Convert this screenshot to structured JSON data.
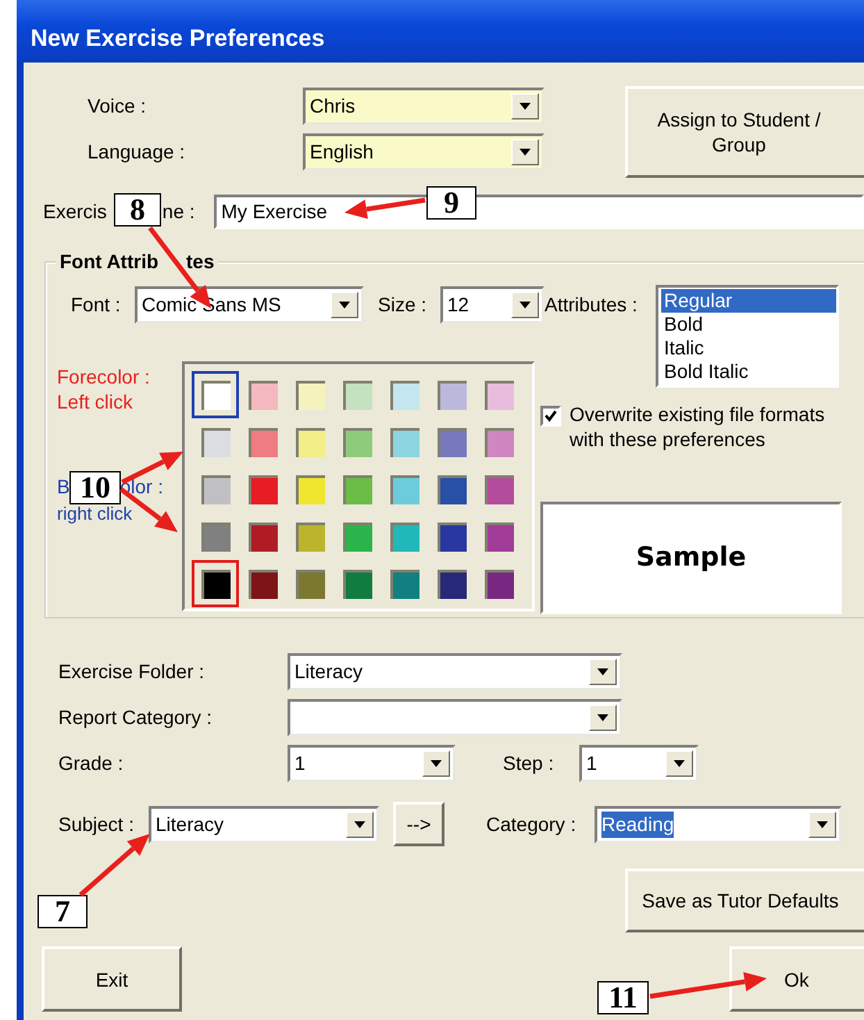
{
  "window": {
    "title": "New Exercise Preferences"
  },
  "voice": {
    "label": "Voice :",
    "value": "Chris"
  },
  "language": {
    "label": "Language :",
    "value": "English"
  },
  "assign_button": "Assign to Student / Group",
  "exercise_name": {
    "label_parts": [
      "Exercis",
      "ne :"
    ],
    "value": "My Exercise"
  },
  "font_attributes": {
    "title_parts": [
      "Font Attrib",
      "tes"
    ],
    "font": {
      "label": "Font :",
      "value": "Comic Sans MS"
    },
    "size": {
      "label": "Size :",
      "value": "12"
    },
    "attributes": {
      "label": "Attributes :",
      "options": [
        {
          "label": "Regular",
          "selected": true
        },
        {
          "label": "Bold",
          "selected": false
        },
        {
          "label": "Italic",
          "selected": false
        },
        {
          "label": "Bold Italic",
          "selected": false
        }
      ]
    },
    "forecolor_label": [
      "Forecolor :",
      "Left click"
    ],
    "backcolor_label": [
      "B",
      "olor :",
      "right click"
    ],
    "swatches": [
      {
        "color": "#ffffff",
        "fore": true,
        "back": false
      },
      {
        "color": "#f4b8c0",
        "fore": false,
        "back": false
      },
      {
        "color": "#f6f2be",
        "fore": false,
        "back": false
      },
      {
        "color": "#c4e2c0",
        "fore": false,
        "back": false
      },
      {
        "color": "#c4e6ee",
        "fore": false,
        "back": false
      },
      {
        "color": "#bcb8dc",
        "fore": false,
        "back": false
      },
      {
        "color": "#e8bcdc",
        "fore": false,
        "back": false
      },
      {
        "color": "#dcdde2",
        "fore": false,
        "back": false
      },
      {
        "color": "#ee7c80",
        "fore": false,
        "back": false
      },
      {
        "color": "#f2ee88",
        "fore": false,
        "back": false
      },
      {
        "color": "#8ecc7c",
        "fore": false,
        "back": false
      },
      {
        "color": "#8cd4e0",
        "fore": false,
        "back": false
      },
      {
        "color": "#7878bc",
        "fore": false,
        "back": false
      },
      {
        "color": "#d086c0",
        "fore": false,
        "back": false
      },
      {
        "color": "#c0c0c4",
        "fore": false,
        "back": false
      },
      {
        "color": "#e81c24",
        "fore": false,
        "back": false
      },
      {
        "color": "#f0e630",
        "fore": false,
        "back": false
      },
      {
        "color": "#6cbc48",
        "fore": false,
        "back": false
      },
      {
        "color": "#6cccdc",
        "fore": false,
        "back": false
      },
      {
        "color": "#2850a4",
        "fore": false,
        "back": false
      },
      {
        "color": "#b44c9c",
        "fore": false,
        "back": false
      },
      {
        "color": "#808080",
        "fore": false,
        "back": false
      },
      {
        "color": "#b01c24",
        "fore": false,
        "back": false
      },
      {
        "color": "#bcb42c",
        "fore": false,
        "back": false
      },
      {
        "color": "#2cb44c",
        "fore": false,
        "back": false
      },
      {
        "color": "#20b8b8",
        "fore": false,
        "back": false
      },
      {
        "color": "#2838a0",
        "fore": false,
        "back": false
      },
      {
        "color": "#a03c98",
        "fore": false,
        "back": false
      },
      {
        "color": "#000000",
        "fore": false,
        "back": true
      },
      {
        "color": "#7c1418",
        "fore": false,
        "back": false
      },
      {
        "color": "#7c7830",
        "fore": false,
        "back": false
      },
      {
        "color": "#107c40",
        "fore": false,
        "back": false
      },
      {
        "color": "#108080",
        "fore": false,
        "back": false
      },
      {
        "color": "#282878",
        "fore": false,
        "back": false
      },
      {
        "color": "#782880",
        "fore": false,
        "back": false
      }
    ],
    "overwrite": {
      "label": "Overwrite existing file formats with these preferences",
      "checked": true
    },
    "sample": "Sample"
  },
  "exercise_folder": {
    "label": "Exercise Folder :",
    "value": "Literacy"
  },
  "report_category": {
    "label": "Report Category :"
  },
  "grade": {
    "label": "Grade :",
    "value": "1"
  },
  "step": {
    "label": "Step :",
    "value": "1"
  },
  "subject": {
    "label": "Subject :",
    "value": "Literacy"
  },
  "arrow_button": "-->",
  "category": {
    "label": "Category :",
    "value": "Reading",
    "highlighted": true
  },
  "save_defaults_button": "Save as Tutor Defaults",
  "exit_button": "Exit",
  "ok_button": "Ok",
  "callouts": [
    {
      "label": "8"
    },
    {
      "label": "9"
    },
    {
      "label": "10"
    },
    {
      "label": "7"
    },
    {
      "label": "11"
    }
  ]
}
